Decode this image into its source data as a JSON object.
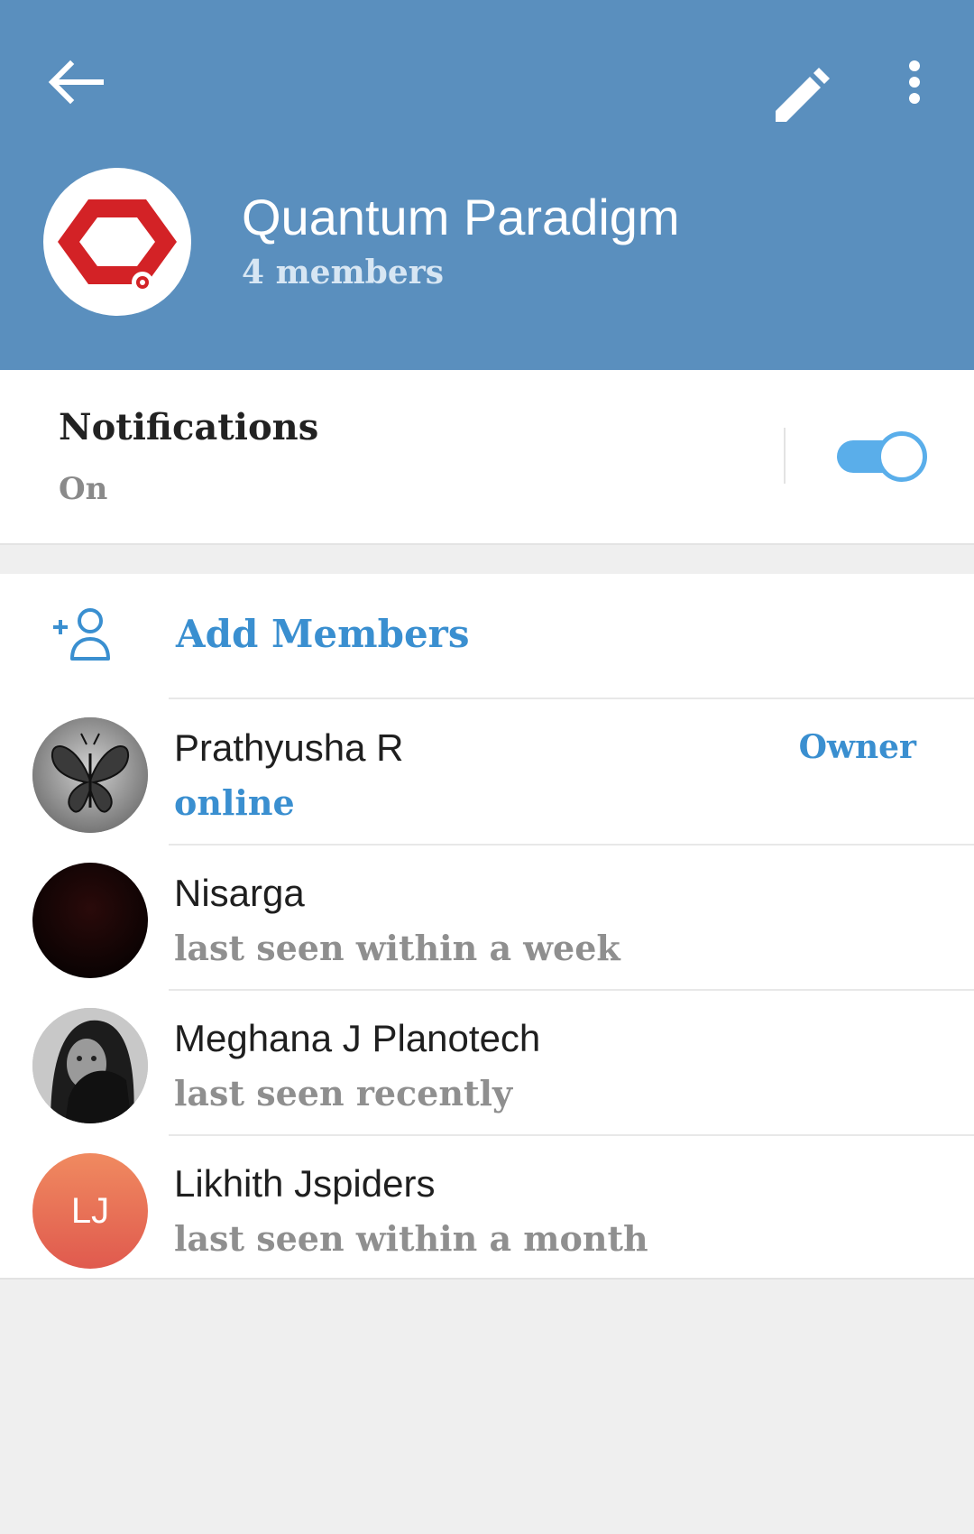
{
  "header": {
    "title": "Quantum Paradigm",
    "subtitle": "4 members",
    "back_icon": "arrow-left-icon",
    "edit_icon": "pencil-icon",
    "more_icon": "more-vertical-icon",
    "background_color": "#5a8fbe"
  },
  "notifications": {
    "title": "Notifications",
    "status": "On",
    "enabled": true,
    "accent_color": "#5aaeea"
  },
  "members_section": {
    "add_label": "Add Members",
    "add_icon": "add-user-icon",
    "members": [
      {
        "name": "Prathyusha R",
        "status": "online",
        "role": "Owner",
        "avatar": "butterfly-photo"
      },
      {
        "name": "Nisarga",
        "status": "last seen within a week",
        "role": "",
        "avatar": "dark-photo"
      },
      {
        "name": "Meghana J Planotech",
        "status": "last seen recently",
        "role": "",
        "avatar": "portrait-photo"
      },
      {
        "name": "Likhith Jspiders",
        "status": "last seen within a month",
        "role": "",
        "avatar": "initials",
        "initials": "LJ"
      }
    ]
  }
}
